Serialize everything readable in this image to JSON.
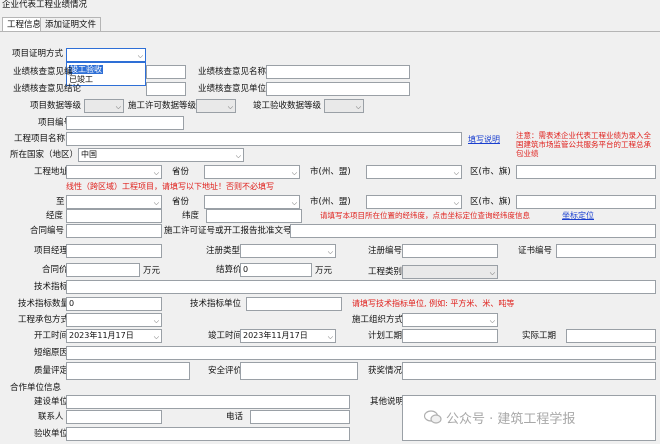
{
  "window": {
    "title": "企业代表工程业绩情况"
  },
  "tabs": [
    "工程信息",
    "添加证明文件"
  ],
  "form": {
    "proof_method_label": "项目证明方式",
    "proof_options": [
      "竣工验收",
      "已竣工"
    ],
    "perf_cert_no_label": "业绩核查意见编",
    "perf_cert_name_label": "业绩核查意见名称",
    "perf_cert_conclusion_label": "业绩核查意见结论",
    "perf_cert_unit_label": "业绩核查意见单位",
    "project_data_level_label": "项目数据等级",
    "permit_data_level_label": "施工许可数据等级",
    "acceptance_data_level_label": "竣工验收数据等级",
    "project_no_label": "项目编号",
    "project_name_label": "工程项目名称",
    "fill_rules_link": "填写说明",
    "notice_red": "注意：需表述企业代表工程业绩为录入全国建筑市场监管公共服务平台的工程总承包业绩",
    "country_label": "所在国家（地区）",
    "country_value": "中国",
    "address_label": "工程地址",
    "province_label": "省份",
    "city_label": "市(州、盟)",
    "district_label": "区(市、旗)",
    "to_label": "至",
    "linear_note": "线性（跨区域）工程项目，请填写以下地址！否则不必填写",
    "longitude_label": "经度",
    "latitude_label": "纬度",
    "coords_note": "请填写本项目所在位置的经纬度，点击坐标定位查询经纬度信息",
    "coords_link": "坐标定位",
    "contract_no_label": "合同编号",
    "permit_no_label": "施工许可证号或开工报告批准文号",
    "pm_label": "项目经理",
    "reg_type_label": "注册类型",
    "reg_no_label": "注册编号",
    "cert_no_label": "证书编号",
    "contract_price_label": "合同价",
    "contract_price_unit": "万元",
    "settle_price_label": "结算价",
    "settle_price_value": "0",
    "settle_price_unit": "万元",
    "project_type_label": "工程类别",
    "tech_index_label": "技术指标",
    "tech_qty_label": "技术指标数量",
    "tech_qty_value": "0",
    "tech_unit_label": "技术指标单位",
    "tech_unit_note": "请填写技术指标单位, 例如: 平方米、米、吨等",
    "contract_mode_label": "工程承包方式",
    "org_mode_label": "施工组织方式",
    "start_time_label": "开工时间",
    "start_time_value": "2023年11月17日",
    "finish_time_label": "竣工时间",
    "finish_time_value": "2023年11月17日",
    "plan_period_label": "计划工期",
    "actual_period_label": "实际工期",
    "shorten_reason_label": "短缩原因",
    "quality_label": "质量评定",
    "safety_label": "安全评价",
    "awards_label": "获奖情况",
    "partners_section": "合作单位信息",
    "builder_label": "建设单位",
    "other_label": "其他说明",
    "contact_label": "联系人",
    "phone_label": "电话",
    "acceptance_unit_label": "验收单位"
  },
  "watermark": "公众号 · 建筑工程学报"
}
